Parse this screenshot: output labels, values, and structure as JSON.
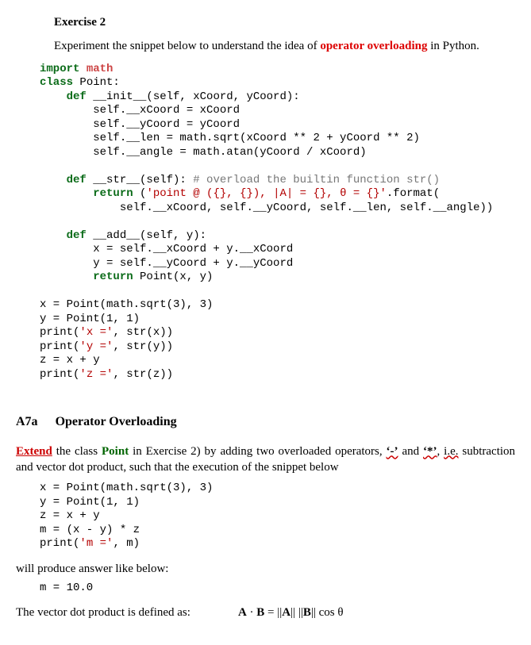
{
  "ex2": {
    "title": "Exercise 2"
  },
  "intro": {
    "pre": "Experiment the snippet below to understand the idea of ",
    "opov": "operator overloading",
    "post": " in Python."
  },
  "code1": {
    "l01a": "import",
    "l01b": " math",
    "l02a": "class",
    "l02b": " Point:",
    "l03a": "    def",
    "l03b": " __init__(self, xCoord, yCoord):",
    "l04": "        self.__xCoord = xCoord",
    "l05": "        self.__yCoord = yCoord",
    "l06": "        self.__len = math.sqrt(xCoord ** 2 + yCoord ** 2)",
    "l07": "        self.__angle = math.atan(yCoord / xCoord)",
    "blank1": "",
    "l08a": "    def",
    "l08b": " __str__(self): ",
    "l08c": "# overload the builtin function str()",
    "l09a": "        return",
    "l09b": " (",
    "l09s": "'point @ ({}, {}), |A| = {}, θ = {}'",
    "l09c": ".format(",
    "l10": "            self.__xCoord, self.__yCoord, self.__len, self.__angle))",
    "blank2": "",
    "l11a": "    def",
    "l11b": " __add__(self, y):",
    "l12": "        x = self.__xCoord + y.__xCoord",
    "l13": "        y = self.__yCoord + y.__yCoord",
    "l14a": "        return",
    "l14b": " Point(x, y)",
    "blank3": "",
    "l15": "x = Point(math.sqrt(3), 3)",
    "l16": "y = Point(1, 1)",
    "l17a": "print(",
    "l17s": "'x ='",
    "l17b": ", str(x))",
    "l18a": "print(",
    "l18s": "'y ='",
    "l18b": ", str(y))",
    "l19": "z = x + y",
    "l20a": "print(",
    "l20s": "'z ='",
    "l20b": ", str(z))"
  },
  "a7a": {
    "num": "A7a",
    "title": "Operator Overloading"
  },
  "extend_para": {
    "t1": "Extend",
    "t2": " the class ",
    "t3": "Point",
    "t4": " in Exercise 2) by adding two overloaded operators, ",
    "sym1": "‘-’",
    "t5": " and ",
    "sym2": "‘*’",
    "t6": ", ",
    "ie": "i.e.",
    "t7": " subtraction and vector dot product, such that the execution of the snippet below"
  },
  "code2": {
    "l1": "x = Point(math.sqrt(3), 3)",
    "l2": "y = Point(1, 1)",
    "l3": "z = x + y",
    "l4": "m = (x - y) * z",
    "l5a": "print(",
    "l5s": "'m ='",
    "l5b": ", m)"
  },
  "produce": "will produce answer like below:",
  "output": "m = 10.0",
  "dot_def": {
    "label": "The vector dot product is defined as:",
    "formula": "A · B = ||A|| ||B|| cos θ"
  }
}
